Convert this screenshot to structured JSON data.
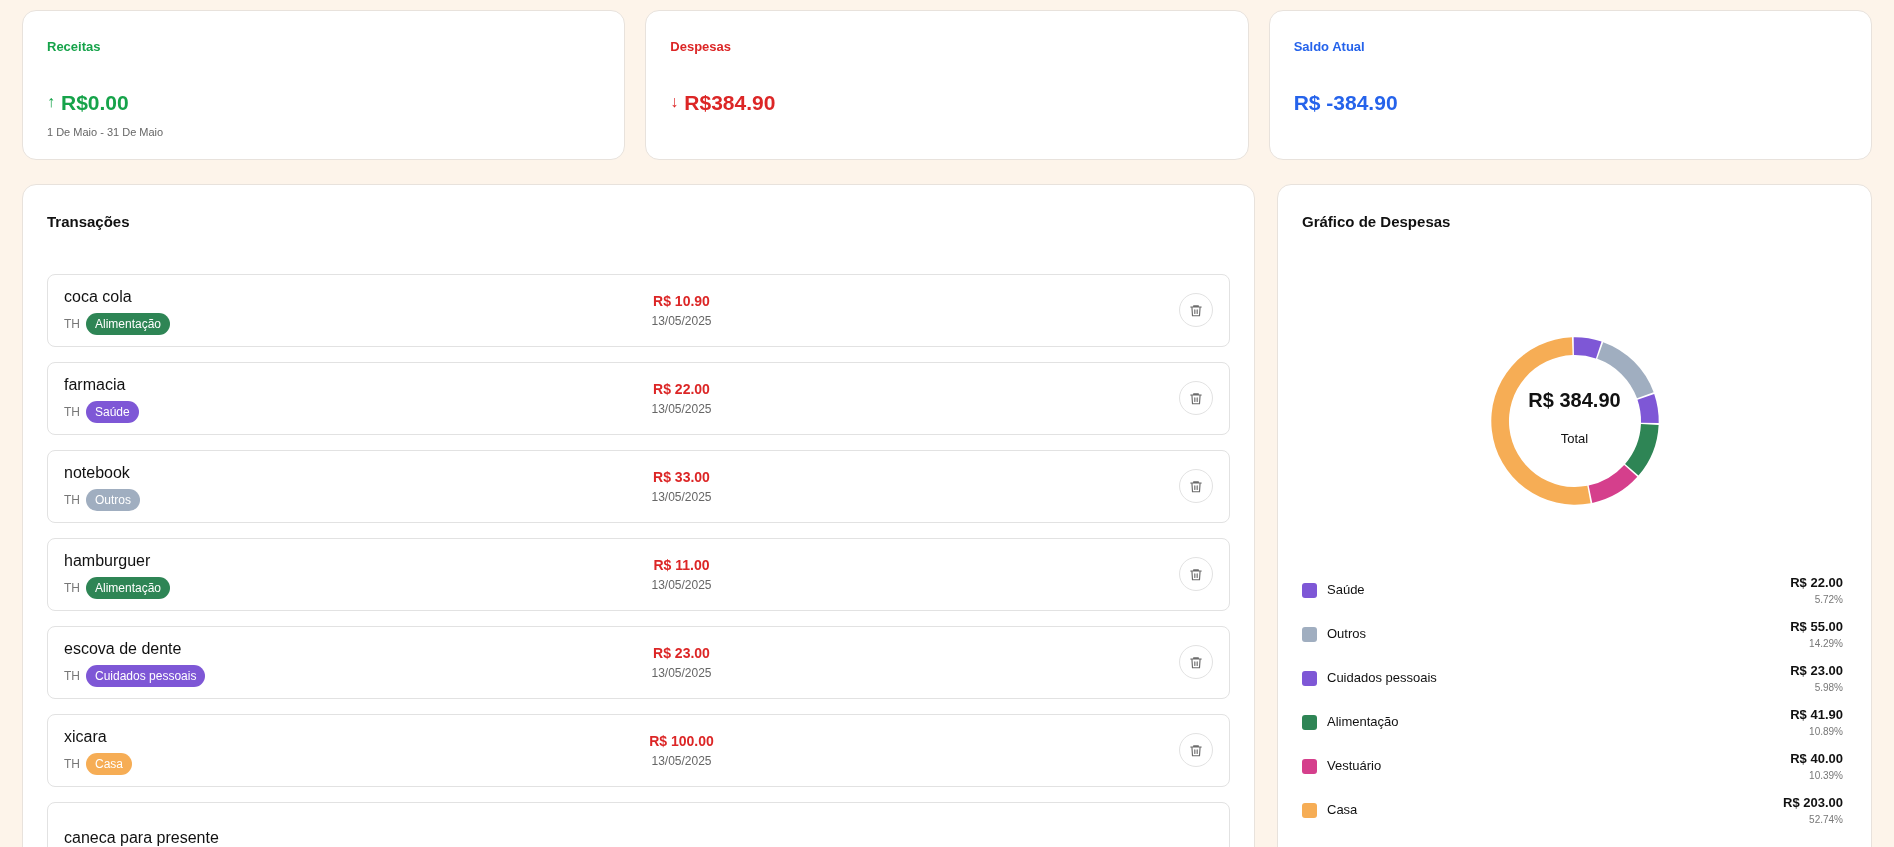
{
  "summary_cards": [
    {
      "kind": "income",
      "title": "Receitas",
      "arrow": "↑",
      "value": "R$0.00",
      "period": "1 De Maio - 31 De Maio"
    },
    {
      "kind": "expense",
      "title": "Despesas",
      "arrow": "↓",
      "value": "R$384.90"
    },
    {
      "kind": "balance",
      "title": "Saldo Atual",
      "value": "R$ -384.90"
    }
  ],
  "transactions": {
    "title": "Transações",
    "rows": [
      {
        "name": "coca cola",
        "user": "TH",
        "category": "Alimentação",
        "color": "#2e8555",
        "amount": "R$ 10.90",
        "date": "13/05/2025"
      },
      {
        "name": "farmacia",
        "user": "TH",
        "category": "Saúde",
        "color": "#7e57d6",
        "amount": "R$ 22.00",
        "date": "13/05/2025"
      },
      {
        "name": "notebook",
        "user": "TH",
        "category": "Outros",
        "color": "#a0aec0",
        "amount": "R$ 33.00",
        "date": "13/05/2025"
      },
      {
        "name": "hamburguer",
        "user": "TH",
        "category": "Alimentação",
        "color": "#2e8555",
        "amount": "R$ 11.00",
        "date": "13/05/2025"
      },
      {
        "name": "escova de dente",
        "user": "TH",
        "category": "Cuidados pessoais",
        "color": "#7e57d6",
        "amount": "R$ 23.00",
        "date": "13/05/2025"
      },
      {
        "name": "xicara",
        "user": "TH",
        "category": "Casa",
        "color": "#f6ad55",
        "amount": "R$ 100.00",
        "date": "13/05/2025"
      },
      {
        "name": "caneca para presente"
      }
    ]
  },
  "chart": {
    "title": "Gráfico de Despesas",
    "total": "R$ 384.90",
    "total_label": "Total",
    "chart_data": {
      "type": "donut",
      "categories": [
        "Saúde",
        "Outros",
        "Cuidados pessoais",
        "Alimentação",
        "Vestuário",
        "Casa"
      ],
      "series": [
        {
          "colors": [
            "#7e57d6",
            "#a0aec0",
            "#7e57d6",
            "#2e8555",
            "#d53f8c",
            "#f6ad55"
          ],
          "values": [
            5.72,
            14.29,
            5.98,
            10.89,
            10.39,
            52.74
          ]
        }
      ]
    },
    "legend": [
      {
        "amount": "R$ 22.00",
        "percent": "5.72%"
      },
      {
        "amount": "R$ 55.00",
        "percent": "14.29%"
      },
      {
        "amount": "R$ 23.00",
        "percent": "5.98%"
      },
      {
        "amount": "R$ 41.90",
        "percent": "10.89%"
      },
      {
        "amount": "R$ 40.00",
        "percent": "10.39%"
      },
      {
        "amount": "R$ 203.00",
        "percent": "52.74%"
      }
    ]
  }
}
